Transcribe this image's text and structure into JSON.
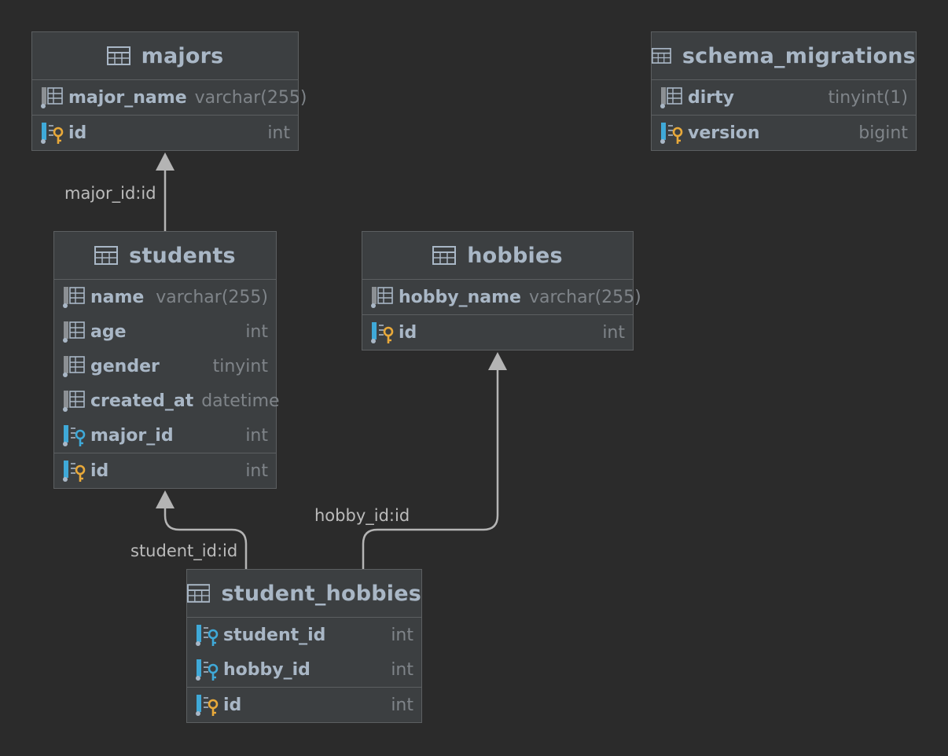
{
  "tables": {
    "majors": {
      "title": "majors",
      "columns": [
        {
          "name": "major_name",
          "type": "varchar(255)",
          "kind": "column"
        }
      ],
      "keys": [
        {
          "name": "id",
          "type": "int",
          "kind": "primary-key"
        }
      ]
    },
    "schema_migrations": {
      "title": "schema_migrations",
      "columns": [
        {
          "name": "dirty",
          "type": "tinyint(1)",
          "kind": "column"
        },
        {
          "name": "version",
          "type": "bigint",
          "kind": "primary-key"
        }
      ]
    },
    "students": {
      "title": "students",
      "columns": [
        {
          "name": "name",
          "type": "varchar(255)",
          "kind": "column"
        },
        {
          "name": "age",
          "type": "int",
          "kind": "column"
        },
        {
          "name": "gender",
          "type": "tinyint",
          "kind": "column"
        },
        {
          "name": "created_at",
          "type": "datetime",
          "kind": "column"
        },
        {
          "name": "major_id",
          "type": "int",
          "kind": "foreign-key"
        }
      ],
      "keys": [
        {
          "name": "id",
          "type": "int",
          "kind": "primary-key"
        }
      ]
    },
    "hobbies": {
      "title": "hobbies",
      "columns": [
        {
          "name": "hobby_name",
          "type": "varchar(255)",
          "kind": "column"
        }
      ],
      "keys": [
        {
          "name": "id",
          "type": "int",
          "kind": "primary-key"
        }
      ]
    },
    "student_hobbies": {
      "title": "student_hobbies",
      "columns": [
        {
          "name": "student_id",
          "type": "int",
          "kind": "foreign-key"
        },
        {
          "name": "hobby_id",
          "type": "int",
          "kind": "foreign-key"
        }
      ],
      "keys": [
        {
          "name": "id",
          "type": "int",
          "kind": "primary-key"
        }
      ]
    }
  },
  "relations": {
    "students_majors": "major_id:id",
    "student_hobbies_students": "student_id:id",
    "student_hobbies_hobbies": "hobby_id:id"
  },
  "colors": {
    "background": "#2b2b2b",
    "table_fill": "#3c3f41",
    "border": "#5c5f61",
    "column_text": "#a9b7c6",
    "type_text": "#7f8489",
    "edge": "#b4b4b4",
    "primary_key": "#e8a93a",
    "foreign_key": "#3fa9d8"
  }
}
